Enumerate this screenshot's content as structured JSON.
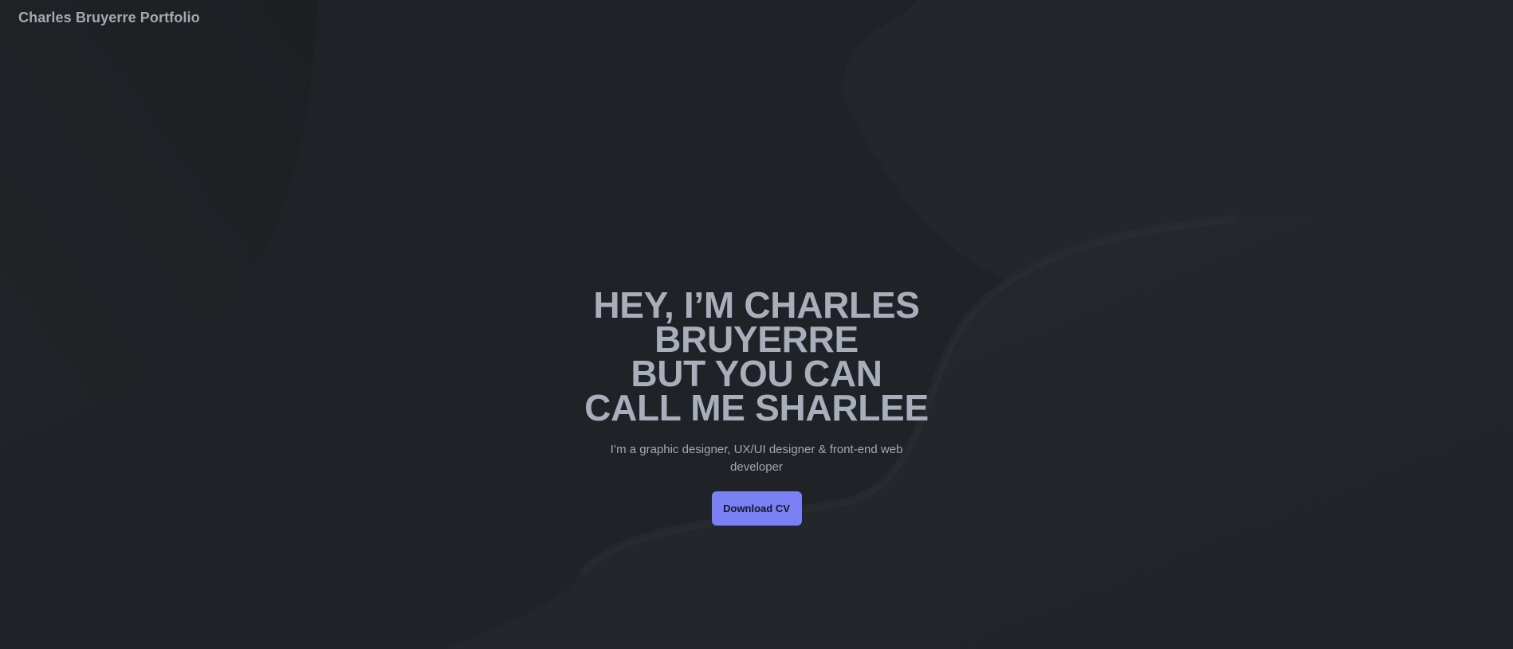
{
  "header": {
    "brand": "Charles Bruyerre Portfolio"
  },
  "hero": {
    "headline_lines": [
      "HEY, I’M CHARLES",
      "BRUYERRE",
      "BUT YOU CAN",
      "CALL ME SHARLEE"
    ],
    "subtitle": "I’m a graphic designer, UX/UI designer & front-end web developer",
    "cta_label": "Download CV"
  },
  "colors": {
    "background": "#1f2226",
    "headline": "#a9aebb",
    "text": "#a4a8b1",
    "accent": "#7b80f5"
  }
}
